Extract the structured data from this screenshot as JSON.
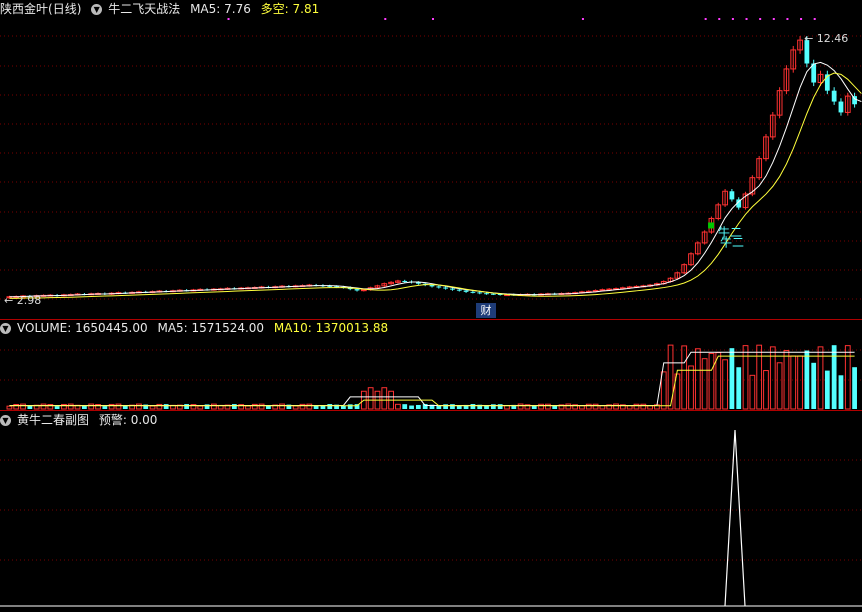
{
  "main_header": {
    "stock_name": "陕西金叶",
    "period": "(日线)",
    "indicator_name": "牛二飞天战法",
    "ma5_text": "MA5: 7.76",
    "duokong_text": "多空: 7.81"
  },
  "volume_header": {
    "volume_text": "VOLUME: 1650445.00",
    "ma5_text": "MA5: 1571524.00",
    "ma10_text": "MA10: 1370013.88"
  },
  "sub_header": {
    "indicator_name": "黄牛二春副图",
    "alert_text": "预警: 0.00"
  },
  "annotations": {
    "high_label": "12.46",
    "low_label": "2.98",
    "niuer_label": "牛二",
    "cai_label": "财"
  },
  "colors": {
    "up": "#ff3232",
    "down": "#54ffff",
    "ma5": "#ffffff",
    "duokong": "#ffff3c",
    "grid": "#7a0000",
    "signal": "#ff3cff",
    "niuer_box": "#00c800",
    "niuer_text": "#54ffff"
  },
  "chart_data": [
    {
      "type": "candlestick",
      "title": "陕西金叶 (日线)",
      "ylim": [
        2.9,
        13.2
      ],
      "ohlc_note": "daily price series; long flat base near 3.0-3.4, rally to peak 12.46",
      "closes": [
        3.02,
        3.03,
        3.05,
        3.04,
        3.06,
        3.07,
        3.08,
        3.06,
        3.09,
        3.1,
        3.12,
        3.11,
        3.13,
        3.14,
        3.12,
        3.15,
        3.17,
        3.16,
        3.18,
        3.2,
        3.19,
        3.21,
        3.23,
        3.22,
        3.24,
        3.26,
        3.25,
        3.27,
        3.29,
        3.28,
        3.3,
        3.31,
        3.33,
        3.32,
        3.34,
        3.35,
        3.36,
        3.38,
        3.37,
        3.39,
        3.41,
        3.4,
        3.42,
        3.43,
        3.45,
        3.44,
        3.42,
        3.4,
        3.38,
        3.36,
        3.3,
        3.25,
        3.28,
        3.35,
        3.42,
        3.5,
        3.55,
        3.6,
        3.58,
        3.55,
        3.5,
        3.45,
        3.4,
        3.36,
        3.32,
        3.28,
        3.25,
        3.2,
        3.18,
        3.15,
        3.13,
        3.12,
        3.1,
        3.1,
        3.09,
        3.1,
        3.11,
        3.1,
        3.12,
        3.13,
        3.12,
        3.14,
        3.15,
        3.17,
        3.2,
        3.22,
        3.25,
        3.28,
        3.3,
        3.32,
        3.35,
        3.38,
        3.4,
        3.42,
        3.45,
        3.5,
        3.58,
        3.7,
        3.9,
        4.2,
        4.6,
        5.0,
        5.4,
        5.9,
        6.4,
        6.9,
        6.6,
        6.3,
        6.8,
        7.4,
        8.1,
        8.9,
        9.7,
        10.6,
        11.4,
        12.1,
        12.46,
        11.6,
        10.9,
        11.2,
        10.6,
        10.2,
        9.8,
        10.4,
        10.1
      ],
      "ma5": [
        3.02,
        3.02,
        3.03,
        3.04,
        3.05,
        3.05,
        3.06,
        3.06,
        3.07,
        3.08,
        3.09,
        3.1,
        3.11,
        3.12,
        3.12,
        3.13,
        3.14,
        3.15,
        3.16,
        3.17,
        3.18,
        3.19,
        3.2,
        3.21,
        3.22,
        3.23,
        3.24,
        3.25,
        3.26,
        3.27,
        3.28,
        3.29,
        3.3,
        3.31,
        3.32,
        3.33,
        3.34,
        3.35,
        3.36,
        3.37,
        3.38,
        3.39,
        3.4,
        3.41,
        3.42,
        3.43,
        3.43,
        3.43,
        3.42,
        3.4,
        3.37,
        3.34,
        3.31,
        3.31,
        3.32,
        3.36,
        3.42,
        3.48,
        3.53,
        3.56,
        3.56,
        3.54,
        3.5,
        3.45,
        3.41,
        3.36,
        3.32,
        3.28,
        3.25,
        3.22,
        3.19,
        3.16,
        3.14,
        3.12,
        3.11,
        3.1,
        3.1,
        3.1,
        3.1,
        3.11,
        3.12,
        3.12,
        3.13,
        3.14,
        3.16,
        3.18,
        3.2,
        3.23,
        3.25,
        3.28,
        3.3,
        3.33,
        3.36,
        3.39,
        3.42,
        3.46,
        3.5,
        3.57,
        3.66,
        3.8,
        4.0,
        4.27,
        4.62,
        5.02,
        5.46,
        5.92,
        6.26,
        6.52,
        6.72,
        6.88,
        7.1,
        7.46,
        7.96,
        8.56,
        9.24,
        9.98,
        10.72,
        11.3,
        11.58,
        11.64,
        11.54,
        11.34,
        11.04,
        10.66,
        10.3,
        10.2
      ]
    },
    {
      "type": "bar",
      "title": "VOLUME",
      "series": [
        {
          "name": "VOLUME",
          "values": [
            1650445
          ]
        },
        {
          "name": "MA5",
          "values": [
            1571524
          ]
        },
        {
          "name": "MA10",
          "values": [
            1370013.88
          ]
        }
      ],
      "ylim": [
        0,
        2000000
      ]
    },
    {
      "type": "line",
      "title": "黄牛二春副图",
      "series": [
        {
          "name": "预警",
          "values": [
            0.0
          ]
        }
      ],
      "ylim": [
        0,
        1
      ]
    }
  ]
}
